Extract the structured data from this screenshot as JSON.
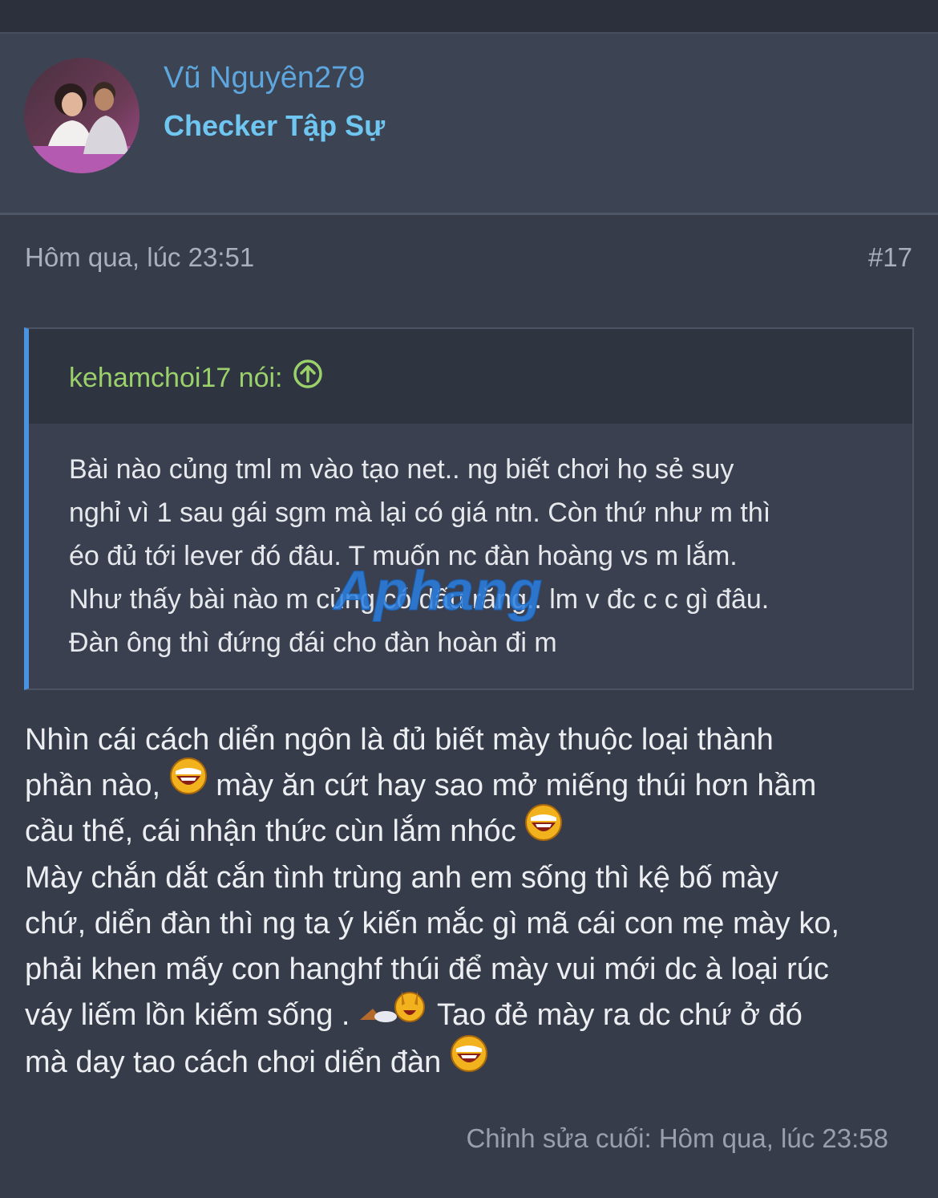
{
  "user": {
    "name": "Vũ Nguyên279",
    "title": "Checker Tập Sự"
  },
  "post": {
    "date": "Hôm qua, lúc 23:51",
    "number": "#17",
    "quote": {
      "author": "kehamchoi17 nói:",
      "lines": [
        "Bài nào củng tml m vào tạo net.. ng biết chơi họ sẻ suy",
        "nghỉ vì 1 sau gái sgm mà lại có giá ntn. Còn thứ như m thì",
        "éo đủ tới lever đó đâu. T muốn nc đàn hoàng vs m lắm.",
        "Như thấy bài nào m củng có dấu răng.. lm v đc c c gì đâu.",
        "Đàn ông thì đứng đái cho đàn hoàn đi m"
      ]
    },
    "body": {
      "l1": "Nhìn cái cách diển ngôn là đủ biết mày thuộc loại thành",
      "l2a": "phần nào,",
      "l2b": "mày ăn cứt hay sao mở miếng thúi hơn hầm",
      "l3": "cầu thế, cái nhận thức cùn lắm nhóc",
      "l4": "Mày chắn dắt cắn tình trùng anh em sống thì kệ bố mày",
      "l5": "chứ, diển đàn thì ng ta ý kiến mắc gì mã cái con mẹ mày ko,",
      "l6": "phải khen mấy con hanghf thúi để mày vui mới dc à loại rúc",
      "l7a": "váy liếm lồn kiếm sống .",
      "l7b": "Tao đẻ mày ra dc chứ ở đó",
      "l8": "mà day tao cách chơi diển đàn"
    },
    "edit_note": "Chỉnh sửa cuối: Hôm qua, lúc 23:58"
  },
  "watermark": "Aphang",
  "colors": {
    "background": "#363c4a",
    "username": "#5ea6de",
    "usertitle": "#6fc6f0",
    "quote_author": "#9bd16a",
    "quote_border": "#4a93e0"
  },
  "icons": {
    "quote_link": "arrow-up-circle-icon",
    "laugh": "laughing-emoji-icon",
    "gesture": "thumbs-up-emoji-icon"
  }
}
